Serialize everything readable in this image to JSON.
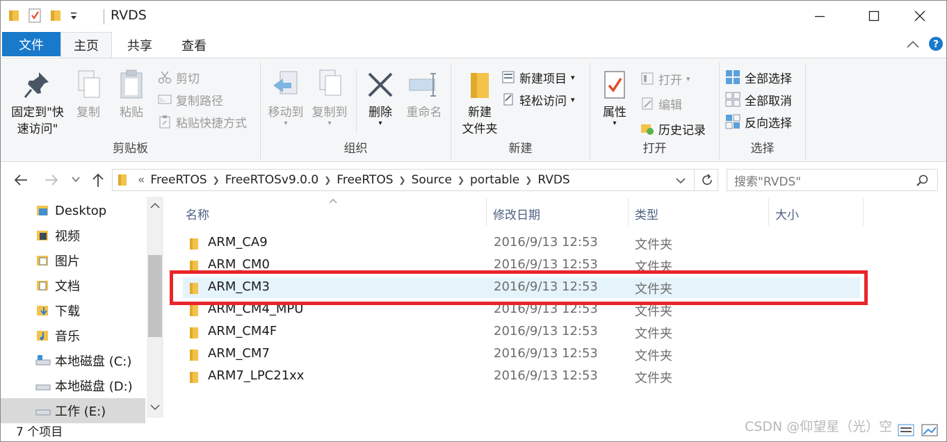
{
  "window": {
    "title": "RVDS"
  },
  "tabs": {
    "file": "文件",
    "home": "主页",
    "share": "共享",
    "view": "查看"
  },
  "ribbon": {
    "clipboard": {
      "label": "剪贴板",
      "pin_line1": "固定到\"快",
      "pin_line2": "速访问\"",
      "copy": "复制",
      "paste": "粘贴",
      "cut": "剪切",
      "copy_path": "复制路径",
      "paste_shortcut": "粘贴快捷方式"
    },
    "organize": {
      "label": "组织",
      "move_to": "移动到",
      "copy_to": "复制到",
      "delete": "删除",
      "rename": "重命名"
    },
    "new": {
      "label": "新建",
      "new_folder_line1": "新建",
      "new_folder_line2": "文件夹",
      "new_item": "新建项目",
      "easy_access": "轻松访问"
    },
    "open": {
      "label": "打开",
      "properties": "属性",
      "open": "打开",
      "edit": "编辑",
      "history": "历史记录"
    },
    "select": {
      "label": "选择",
      "select_all": "全部选择",
      "select_none": "全部取消",
      "invert": "反向选择"
    }
  },
  "address": {
    "overflow": "«",
    "crumbs": [
      "FreeRTOS",
      "FreeRTOSv9.0.0",
      "FreeRTOS",
      "Source",
      "portable",
      "RVDS"
    ]
  },
  "search": {
    "placeholder": "搜索\"RVDS\""
  },
  "nav": {
    "items": [
      "Desktop",
      "视频",
      "图片",
      "文档",
      "下载",
      "音乐",
      "本地磁盘 (C:)",
      "本地磁盘 (D:)",
      "工作 (E:)"
    ]
  },
  "columns": {
    "name": "名称",
    "modified": "修改日期",
    "type": "类型",
    "size": "大小"
  },
  "files": [
    {
      "name": "ARM_CA9",
      "modified": "2016/9/13 12:53",
      "type": "文件夹"
    },
    {
      "name": "ARM_CM0",
      "modified": "2016/9/13 12:53",
      "type": "文件夹"
    },
    {
      "name": "ARM_CM3",
      "modified": "2016/9/13 12:53",
      "type": "文件夹"
    },
    {
      "name": "ARM_CM4_MPU",
      "modified": "2016/9/13 12:53",
      "type": "文件夹"
    },
    {
      "name": "ARM_CM4F",
      "modified": "2016/9/13 12:53",
      "type": "文件夹"
    },
    {
      "name": "ARM_CM7",
      "modified": "2016/9/13 12:53",
      "type": "文件夹"
    },
    {
      "name": "ARM7_LPC21xx",
      "modified": "2016/9/13 12:53",
      "type": "文件夹"
    }
  ],
  "status": {
    "count": "7 个项目"
  },
  "watermark": "CSDN @仰望星（光）空",
  "colors": {
    "accent": "#1979ca",
    "highlight": "#e8262a",
    "folder": "#f3c24a"
  }
}
